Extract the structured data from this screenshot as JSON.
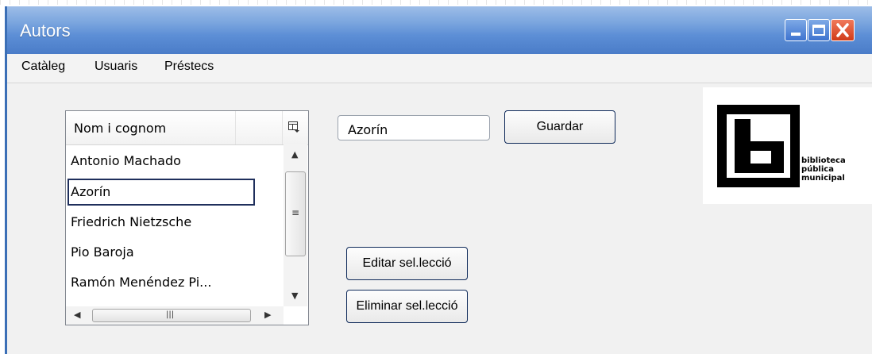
{
  "window": {
    "title": "Autors"
  },
  "menu": [
    "Catàleg",
    "Usuaris",
    "Préstecs"
  ],
  "list": {
    "header": "Nom i cognom",
    "items": [
      "Antonio Machado",
      "Azorín",
      "Friedrich Nietzsche",
      "Pio Baroja",
      "Ramón Menéndez Pi..."
    ],
    "selected_index": 1
  },
  "editor": {
    "value": "Azorín",
    "save_label": "Guardar"
  },
  "actions": {
    "edit_label": "Editar sel.lecció",
    "delete_label": "Eliminar sel.lecció"
  },
  "logo": {
    "line1": "biblioteca",
    "line2": "pública",
    "line3": "municipal"
  },
  "colors": {
    "titlebar": "#5d8fd6",
    "close_button": "#d03a18",
    "selection_border": "#1f2f5c",
    "button_border": "#0f2a5a"
  }
}
